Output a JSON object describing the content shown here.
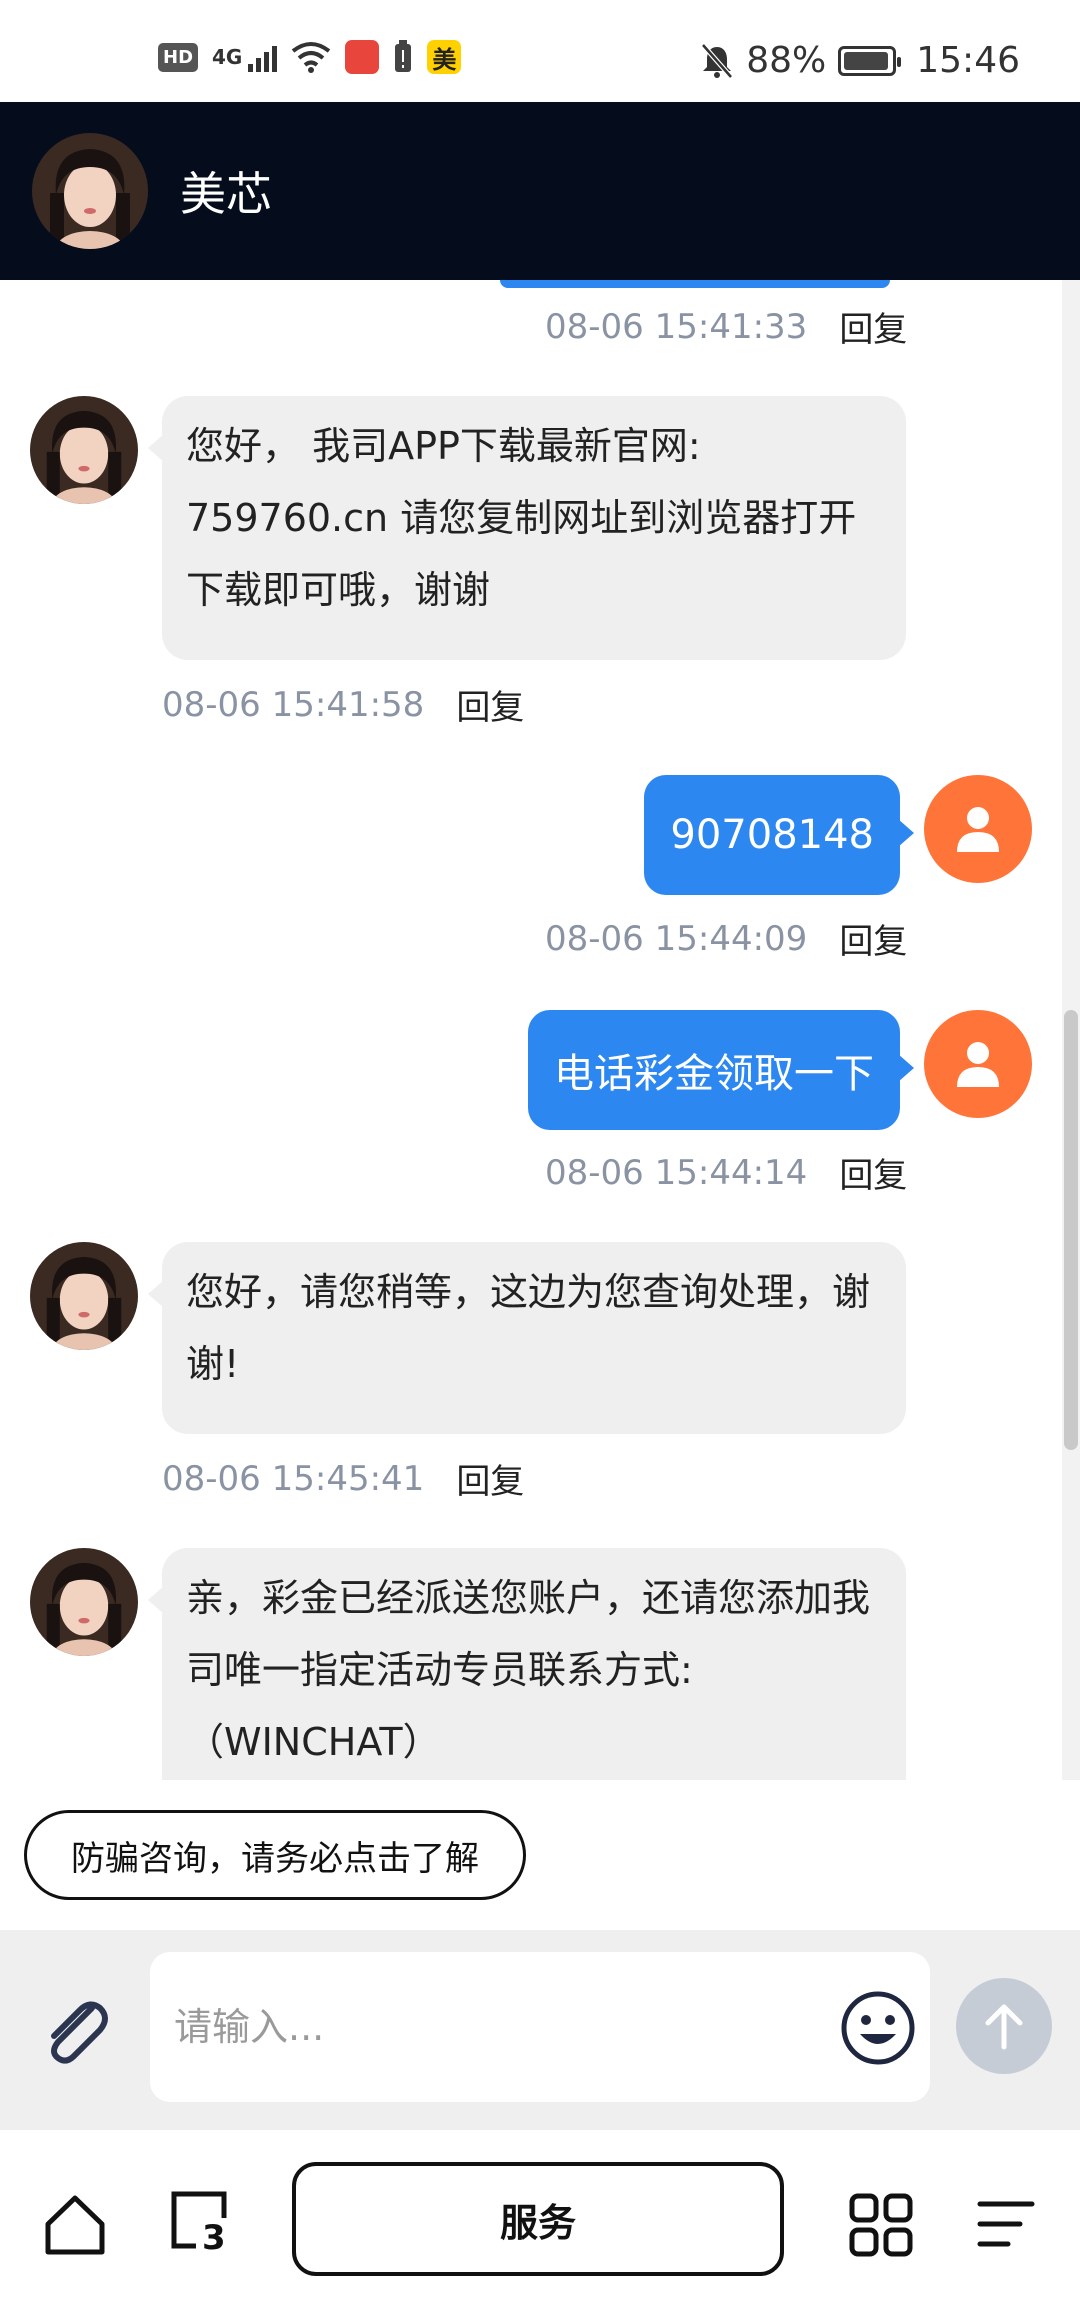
{
  "status_bar": {
    "hd": "HD",
    "network": "4G",
    "app_icon_label": "美",
    "battery": "88%",
    "time": "15:46"
  },
  "header": {
    "contact_name": "美芯"
  },
  "messages": [
    {
      "type": "meta",
      "side": "out",
      "time": "08-06 15:41:33",
      "reply": "回复"
    },
    {
      "type": "text",
      "side": "in",
      "text": "您好， 我司APP下载最新官网: 759760.cn 请您复制网址到浏览器打开下载即可哦，谢谢",
      "time": "08-06 15:41:58",
      "reply": "回复"
    },
    {
      "type": "text",
      "side": "out",
      "text": "90708148",
      "time": "08-06 15:44:09",
      "reply": "回复"
    },
    {
      "type": "text",
      "side": "out",
      "text": "电话彩金领取一下",
      "time": "08-06 15:44:14",
      "reply": "回复"
    },
    {
      "type": "text",
      "side": "in",
      "text": "您好，请您稍等，这边为您查询处理，谢谢!",
      "time": "08-06 15:45:41",
      "reply": "回复"
    },
    {
      "type": "text",
      "side": "in",
      "text": "亲，彩金已经派送您账户，还请您添加我司唯一指定活动专员联系方式:（WINCHAT）",
      "time": "",
      "reply": ""
    }
  ],
  "notice": {
    "label": "防骗咨询，请务必点击了解"
  },
  "input": {
    "placeholder": "请输入..."
  },
  "bottom_nav": {
    "tab_count": "3",
    "service_label": "服务"
  },
  "colors": {
    "header_bg": "#050d1d",
    "outgoing_bubble": "#2d87f0",
    "incoming_bubble": "#efefef",
    "user_avatar": "#ff7438",
    "send_disabled": "#c6ccd6"
  }
}
